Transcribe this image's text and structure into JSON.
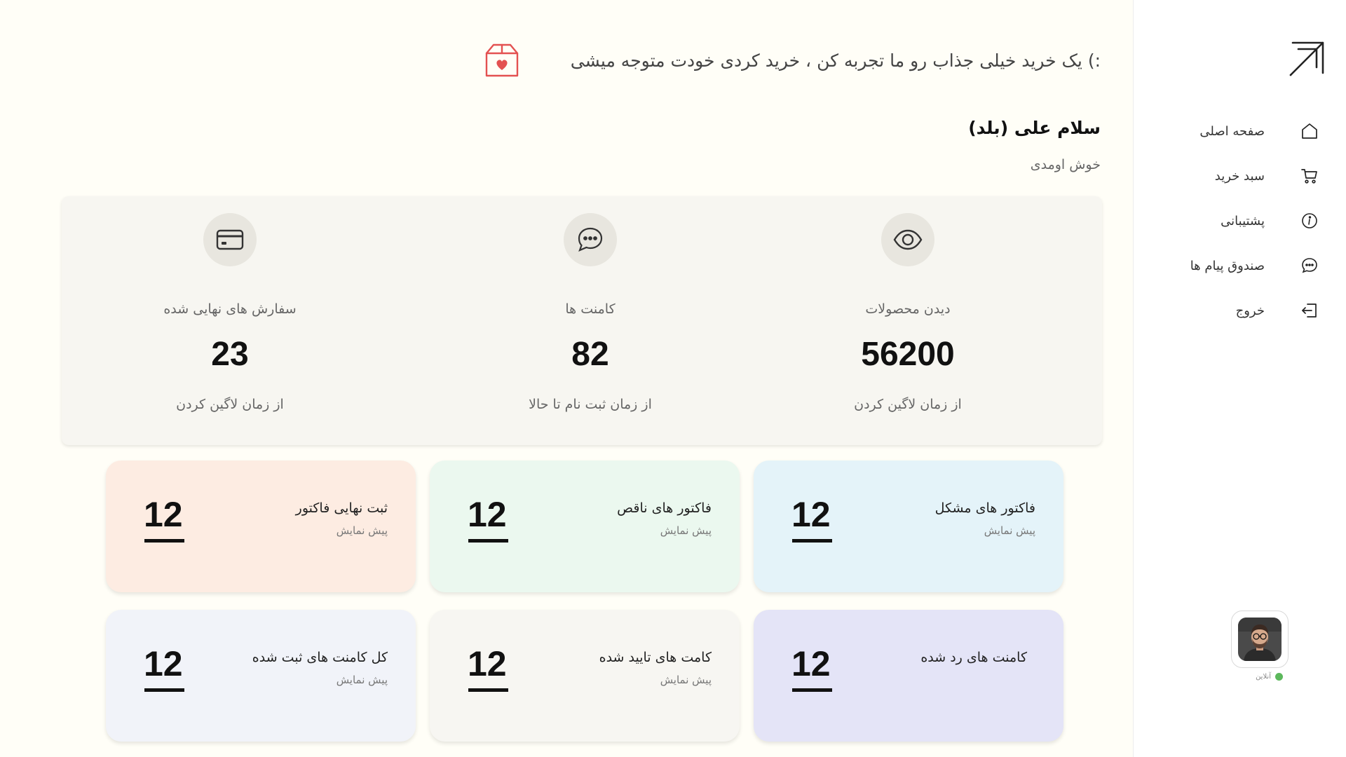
{
  "banner": {
    "text": ":)  یک خرید خیلی جذاب رو ما تجربه کن ، خرید کردی خودت متوجه میشی",
    "icon": "gift-box-heart-icon",
    "icon_color": "#e35151"
  },
  "greeting": {
    "title": "سلام علی (بلد)",
    "subtitle": "خوش اومدی"
  },
  "stats": [
    {
      "icon": "eye-icon",
      "title": "دیدن محصولات",
      "value": "56200",
      "sub": "از زمان لاگین کردن"
    },
    {
      "icon": "chat-bubble-icon",
      "title": "کامنت ها",
      "value": "82",
      "sub": "از زمان ثبت نام تا حالا"
    },
    {
      "icon": "credit-card-icon",
      "title": "سفارش های نهایی شده",
      "value": "23",
      "sub": "از زمان لاگین کردن"
    }
  ],
  "cards": [
    {
      "title": "فاکتور های مشکل",
      "sub": "پیش نمایش",
      "value": "12",
      "color": "#e4f3f9"
    },
    {
      "title": "فاکتور های ناقص",
      "sub": "پیش نمایش",
      "value": "12",
      "color": "#ebf8ef"
    },
    {
      "title": "ثبت نهایی فاکتور",
      "sub": "پیش نمایش",
      "value": "12",
      "color": "#fdece2"
    },
    {
      "title": "کامنت های رد شده",
      "sub": "",
      "value": "12",
      "color": "#e4e4f7"
    },
    {
      "title": "کامت های تایید شده",
      "sub": "پیش نمایش",
      "value": "12",
      "color": "#f7f6f2"
    },
    {
      "title": "کل کامنت های ثبت شده",
      "sub": "پیش نمایش",
      "value": "12",
      "color": "#f1f3f9"
    }
  ],
  "sidebar": {
    "logo": "arrow-up-right-icon",
    "items": [
      {
        "label": "صفحه اصلی",
        "icon": "home-icon"
      },
      {
        "label": "سبد خرید",
        "icon": "cart-icon"
      },
      {
        "label": "پشتیبانی",
        "icon": "info-icon"
      },
      {
        "label": "صندوق پیام ها",
        "icon": "chat-bubble-icon"
      },
      {
        "label": "خروج",
        "icon": "logout-icon"
      }
    ],
    "user_status": "آنلاین",
    "status_color": "#5cb85c"
  }
}
